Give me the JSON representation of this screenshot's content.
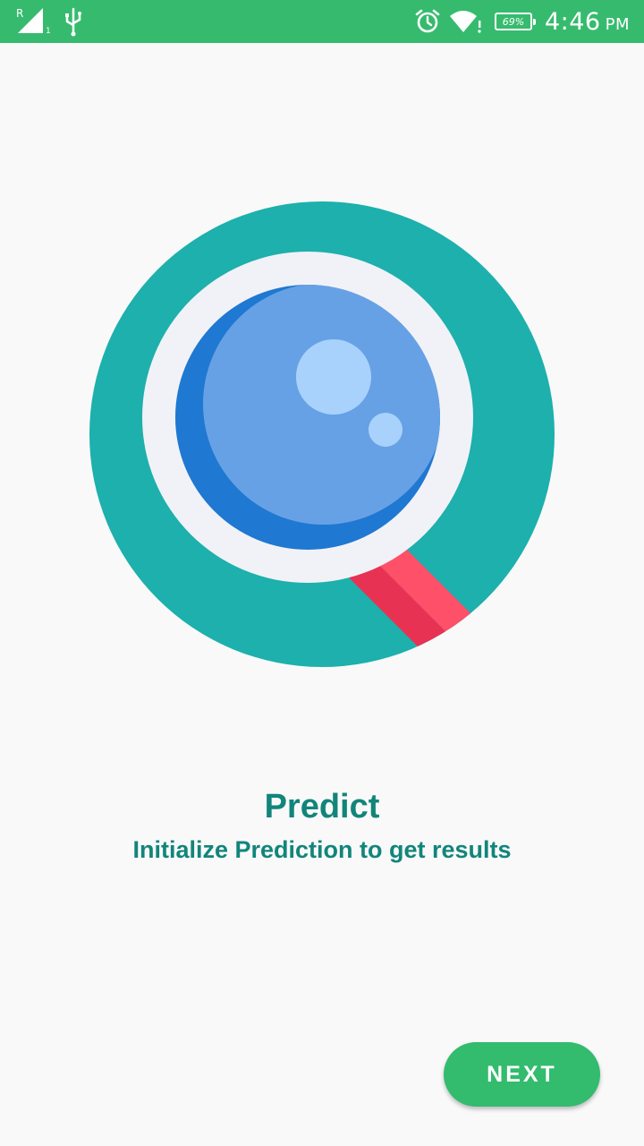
{
  "status_bar": {
    "time": "4:46",
    "ampm": "PM",
    "battery": "69%",
    "roaming_indicator": "R",
    "background_color": "#36bb6e",
    "icons": [
      "signal-icon",
      "usb-icon",
      "alarm-icon",
      "wifi-icon",
      "battery-icon"
    ]
  },
  "onboarding": {
    "illustration_icon": "magnifier-icon",
    "title": "Predict",
    "subtitle": "Initialize Prediction to get results",
    "text_color": "#12857a"
  },
  "actions": {
    "next_label": "NEXT",
    "button_color": "#33bb6e"
  }
}
